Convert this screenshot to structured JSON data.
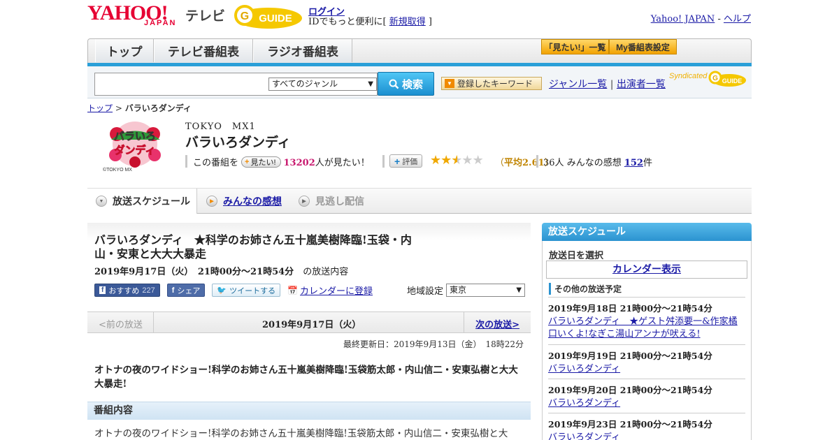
{
  "header": {
    "logo_text": "YAHOO!",
    "logo_sub": "JAPAN",
    "tv_label": "テレビ",
    "gguide_label": "GUIDE",
    "login_label": "ログイン",
    "login_sub_prefix": "IDでもっと便利に[ ",
    "register_label": "新規取得",
    "login_sub_suffix": " ]",
    "yahoo_japan_link": "Yahoo! JAPAN",
    "separator": " - ",
    "help_link": "ヘルプ"
  },
  "nav": {
    "tabs": [
      "トップ",
      "テレビ番組表",
      "ラジオ番組表"
    ],
    "mitai_list_btn": "「見たい!」一覧",
    "my_schedule_btn": "My番組表設定"
  },
  "search": {
    "query": "",
    "genre_selected": "すべてのジャンル",
    "search_btn": "検索",
    "keyword_btn": "登録したキーワード",
    "genre_list_link": "ジャンル一覧",
    "link_separator": " | ",
    "performer_list_link": "出演者一覧",
    "syndicated_label": "Syndicated"
  },
  "breadcrumb": {
    "top": "トップ",
    "separator": " > ",
    "current": "バラいろダンディ"
  },
  "program": {
    "logo_text_top": "バラいろ",
    "logo_text_bottom": "ダンディ",
    "copyright": "©TOKYO MX",
    "station": "TOKYO　MX1",
    "title": "バラいろダンディ",
    "mitai_prefix": "この番組を",
    "mitai_btn": "見たい!",
    "mitai_count": "13202",
    "mitai_suffix": "人が見たい！",
    "eval_btn": "評価",
    "rating": 2.61,
    "avg_open": "（",
    "avg_label": "平均2.61",
    "avg_close": "）",
    "ratings_count_label": "36人",
    "kansou_label": "みんなの感想",
    "kansou_count": "152",
    "kansou_unit": "件"
  },
  "tabs": {
    "schedule": "放送スケジュール",
    "reviews": "みんなの感想",
    "vod": "見逃し配信"
  },
  "episode": {
    "title": "バラいろダンディ　★科学のお姉さん五十嵐美樹降臨!玉袋・内山・安東と大大大暴走",
    "date": "2019年9月17日（火）　21時00分～21時54分",
    "date_suffix": "の放送内容",
    "fb_recommend": "おすすめ",
    "fb_count": "227",
    "fb_share": "シェア",
    "tweet": "ツイートする",
    "calendar_register": "カレンダーに登録",
    "region_label": "地域設定",
    "region_selected": "東京",
    "prev_label": "<前の放送",
    "nav_date": "2019年9月17日（火）",
    "next_label": "次の放送>",
    "updated": "最終更新日：2019年9月13日（金）　18時22分",
    "summary": "オトナの夜のワイドショー!科学のお姉さん五十嵐美樹降臨!玉袋筋太郎・内山信二・安東弘樹と大大大暴走!",
    "section_title": "番組内容",
    "description": "オトナの夜のワイドショー!科学のお姉さん五十嵐美樹降臨!玉袋筋太郎・内山信二・安東弘樹と大"
  },
  "sidebar": {
    "header": "放送スケジュール",
    "select_date_label": "放送日を選択",
    "calendar_btn": "カレンダー表示",
    "other_header": "その他の放送予定",
    "items": [
      {
        "date": "2019年9月18日 21時00分～21時54分",
        "title": "バラいろダンディ　★ゲスト舛添要一&作家橘口いくよ!なぎこ湯山アンナが吠える!"
      },
      {
        "date": "2019年9月19日 21時00分～21時54分",
        "title": "バラいろダンディ"
      },
      {
        "date": "2019年9月20日 21時00分～21時54分",
        "title": "バラいろダンディ"
      },
      {
        "date": "2019年9月23日 21時00分～21時54分",
        "title": "バラいろダンディ"
      }
    ]
  },
  "colors": {
    "yahoo_red": "#e60033",
    "accent_blue": "#2b93d0",
    "mitai_pink": "#c8186e",
    "star_gold": "#f0a800"
  }
}
